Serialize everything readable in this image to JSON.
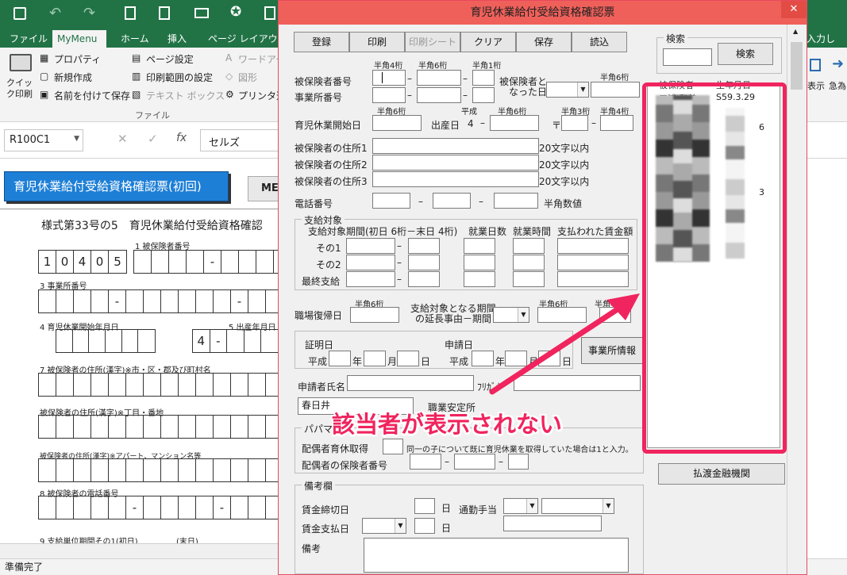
{
  "excel": {
    "tabs": [
      "ファイル",
      "MyMenu",
      "ホーム",
      "挿入",
      "ページ レイアウト"
    ],
    "right_tab_text": "入力してくだ",
    "ribbon": {
      "quick_print": "クイック印刷",
      "properties": "プロパティ",
      "new_create": "新規作成",
      "save_as": "名前を付けて保存",
      "page_setup": "ページ設定",
      "print_area": "印刷範囲の設定",
      "text_box": "テキスト ボックス",
      "wordart": "ワードアート",
      "shapes": "図形",
      "printer": "プリンタ選",
      "group_file": "ファイル",
      "display": "表示",
      "urgent": "急為"
    },
    "name_box": "R100C1",
    "formula": "セルズ",
    "sheet_button": "育児休業給付受給資格確認票(初回)",
    "sheet_button2": "ME",
    "form_title": "様式第33号の5　育児休業給付受給資格確認",
    "label1": "1 被保険者番号",
    "insured_digits": [
      "1",
      "0",
      "4",
      "0",
      "5"
    ],
    "label3": "3 事業所番号",
    "label4": "4 育児休業開始年月日",
    "label5": "5 出産年月日",
    "era_digit": "4",
    "label7": "7 被保険者の住所(漢字)※市・区・郡及び町村名",
    "label7b": "被保険者の住所(漢字)※丁目・番地",
    "label7c": "被保険者の住所(漢字)※アパート、マンション名等",
    "label8": "8 被保険者の電話番号",
    "label9": "9 支給単位期間その1(初日)",
    "label9b": "(末日)",
    "status": "準備完了"
  },
  "dialog": {
    "title": "育児休業給付受給資格確認票",
    "close": "✕",
    "buttons": {
      "register": "登録",
      "print": "印刷",
      "print_sheet": "印刷シート",
      "clear": "クリア",
      "save": "保存",
      "load": "読込"
    },
    "search": {
      "group": "検索",
      "button": "検索"
    },
    "hankaku4": "半角4桁",
    "hankaku6": "半角6桁",
    "hankaku1": "半角1桁",
    "hankaku3": "半角3桁",
    "insured_number": "被保険者番号",
    "office_number": "事業所番号",
    "became_insured": "被保険者と",
    "became_insured2": "なった日",
    "leave_start": "育児休業開始日",
    "heisei": "平成",
    "birth_date": "出産日",
    "birth_era": "4",
    "postal": "〒",
    "addr1": "被保険者の住所1",
    "addr2": "被保険者の住所2",
    "addr3": "被保険者の住所3",
    "max20": "20文字以内",
    "phone": "電話番号",
    "phone_note": "半角数値",
    "payment": {
      "group": "支給対象",
      "period_hdr": "支給対象期間(初日 6桁－末日 4桁)",
      "work_days": "就業日数",
      "work_hours": "就業時間",
      "wages": "支払われた賃金額",
      "row1": "その1",
      "row2": "その2",
      "row3": "最終支給"
    },
    "return_date": "職場復帰日",
    "extension": "支給対象となる期間",
    "extension2": "の延長事由－期間",
    "certify_date": "証明日",
    "apply_date": "申請日",
    "year": "年",
    "month": "月",
    "day": "日",
    "office_info": "事業所情報",
    "applicant": "申請者氏名",
    "furigana": "ﾌﾘｶﾞﾅ",
    "office_name": "春日井",
    "employment_office": "職業安定所",
    "papa_mama": "パパママ",
    "spouse_leave": "配偶者育休取得",
    "spouse_note": "同一の子について既に育児休業を取得していた場合は1と入力。",
    "spouse_number": "配偶者の保険者番号",
    "remarks_group": "備考欄",
    "wage_close": "賃金締切日",
    "commute": "通勤手当",
    "wage_pay": "賃金支払日",
    "remarks": "備考",
    "bank_button": "払渡金融機関",
    "results": [
      {
        "name": "三浦 和美",
        "date": "S59.3.29"
      },
      {
        "name": "",
        "date": "6"
      },
      {
        "name": "",
        "date": "3"
      },
      {
        "name": "",
        "date": ""
      },
      {
        "name": "",
        "date": ""
      }
    ],
    "results_header": {
      "name": "被保険者",
      "date": "生年月日"
    }
  },
  "annotation": "該当者が表示されない"
}
